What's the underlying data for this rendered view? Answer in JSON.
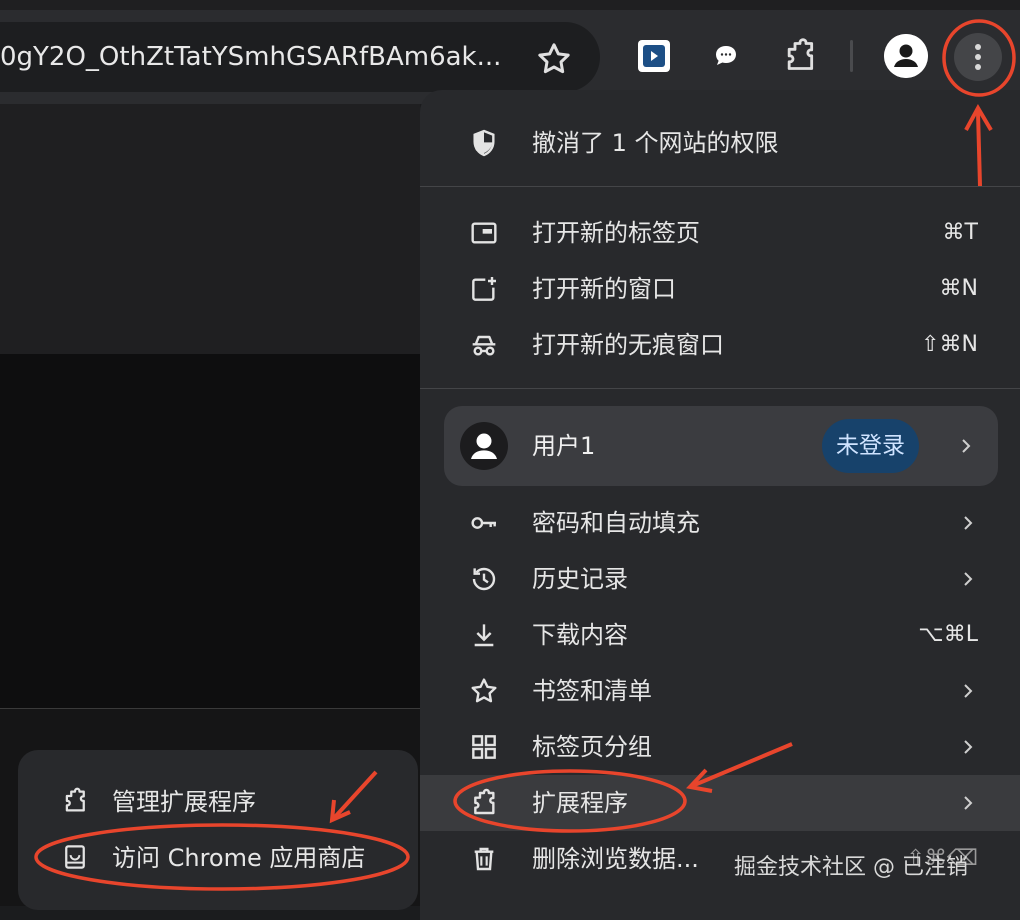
{
  "toolbar": {
    "url_text": "0gY2O_OthZtTatYSmhGSARfBAm6ak...",
    "icons": [
      "star-icon",
      "extension-icon",
      "chat-icon",
      "puzzle-icon",
      "avatar-icon",
      "more-vert-icon"
    ]
  },
  "menu": {
    "permissions": {
      "label": "撤消了 1 个网站的权限",
      "icon": "shield-icon"
    },
    "new_tab": {
      "label": "打开新的标签页",
      "shortcut": "⌘T",
      "icon": "tab-icon"
    },
    "new_window": {
      "label": "打开新的窗口",
      "shortcut": "⌘N",
      "icon": "new-window-icon"
    },
    "incognito": {
      "label": "打开新的无痕窗口",
      "shortcut": "⇧⌘N",
      "icon": "incognito-icon"
    },
    "profile": {
      "name": "用户1",
      "badge": "未登录"
    },
    "passwords": {
      "label": "密码和自动填充",
      "icon": "key-icon"
    },
    "history": {
      "label": "历史记录",
      "icon": "history-icon"
    },
    "downloads": {
      "label": "下载内容",
      "shortcut": "⌥⌘L",
      "icon": "download-icon"
    },
    "bookmarks": {
      "label": "书签和清单",
      "icon": "star-icon"
    },
    "tab_groups": {
      "label": "标签页分组",
      "icon": "grid-icon"
    },
    "extensions": {
      "label": "扩展程序",
      "icon": "puzzle-icon"
    },
    "clear_data": {
      "label": "删除浏览数据...",
      "shortcut": "⇧⌘⌫",
      "icon": "trash-icon"
    }
  },
  "submenu": {
    "manage": {
      "label": "管理扩展程序",
      "icon": "puzzle-icon"
    },
    "store": {
      "label": "访问 Chrome 应用商店",
      "icon": "store-icon"
    }
  },
  "watermark": "掘金技术社区 @ 已注销",
  "colors": {
    "annotation": "#e8452c",
    "badge_bg": "#17426b",
    "menu_bg": "#28292c"
  }
}
